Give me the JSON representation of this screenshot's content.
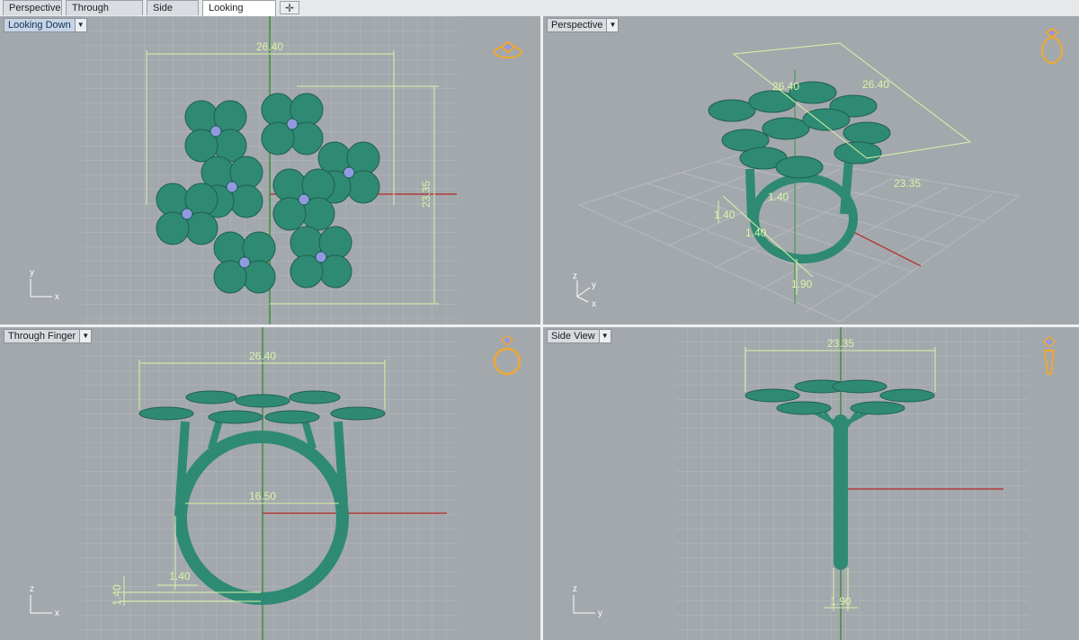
{
  "tabs": [
    {
      "label": "Perspective",
      "active": false
    },
    {
      "label": "Through Finger",
      "active": false
    },
    {
      "label": "Side View",
      "active": false
    },
    {
      "label": "Looking Down",
      "active": true
    }
  ],
  "add_tab_symbol": "✛",
  "viewports": {
    "looking_down": {
      "label": "Looking Down",
      "dims": {
        "width": "26.40",
        "height": "23.35"
      },
      "axes": {
        "v": "y",
        "h": "x"
      },
      "icon": "ring-top-view-icon"
    },
    "perspective": {
      "label": "Perspective",
      "dims": {
        "a": "26.40",
        "b": "23.35",
        "c": "26.40",
        "d": "1.40",
        "e": "1.40",
        "f": "1.40",
        "g": "1.90"
      },
      "axes": {
        "z": "z",
        "y": "y",
        "x": "x"
      },
      "icon": "ring-perspective-icon"
    },
    "through_finger": {
      "label": "Through Finger",
      "dims": {
        "width": "26.40",
        "inner": "16.50",
        "band": "1.40",
        "thick": "1.40"
      },
      "axes": {
        "v": "z",
        "h": "x"
      },
      "icon": "ring-front-icon"
    },
    "side_view": {
      "label": "Side View",
      "dims": {
        "width": "23.35",
        "shank": "1.90"
      },
      "axes": {
        "v": "z",
        "h": "y"
      },
      "icon": "ring-side-icon"
    }
  },
  "colors": {
    "viewport_bg": "#a3a8ad",
    "grid": "#b6babe",
    "model": "#2f8a73",
    "dimension": "#d9f5a8",
    "x_axis": "#b23a3a",
    "y_axis": "#3f8f3f",
    "gem": "#8f9ae0",
    "icon": "#f0a830"
  }
}
